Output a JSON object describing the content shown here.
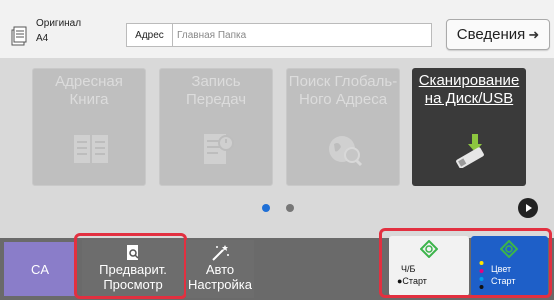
{
  "original": {
    "label": "Оригинал",
    "size": "A4"
  },
  "address": {
    "button_label": "Адрес",
    "placeholder": "Главная Папка"
  },
  "details": {
    "label": "Сведения",
    "arrow": "➜"
  },
  "tiles": [
    {
      "line1": "Адресная",
      "line2": "Книга"
    },
    {
      "line1": "Запись Передач",
      "line2": ""
    },
    {
      "line1": "Поиск Глобаль-",
      "line2": "Ного Адреса"
    },
    {
      "line1": "Сканирование",
      "line2": "на Диск/USB"
    }
  ],
  "bottom": {
    "ca_label": "CA",
    "preview_line1": "Предварит.",
    "preview_line2": "Просмотр",
    "auto_line1": "Авто",
    "auto_line2": "Настройка",
    "bw_line1": "Ч/Б",
    "bw_line2": "●Старт",
    "color_line1": "Цвет",
    "color_line2": "Старт"
  },
  "colors": {
    "ca": "#8a7dc9",
    "highlight": "#e23040",
    "color_start": "#1e5fc8",
    "dot_active": "#1e6fd6"
  }
}
